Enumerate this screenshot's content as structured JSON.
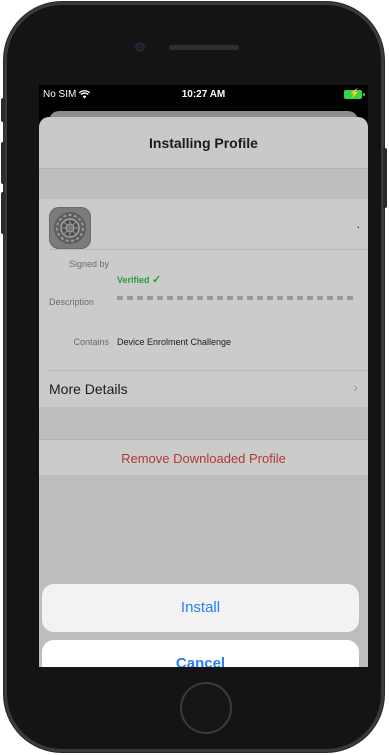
{
  "status_bar": {
    "carrier": "No SIM",
    "time": "10:27 AM"
  },
  "sheet": {
    "title": "Installing Profile"
  },
  "profile": {
    "name": ".",
    "signed_by_label": "Signed by",
    "verified_text": "Verified",
    "description_label": "Description",
    "contains_label": "Contains",
    "contains_value": "Device Enrolment Challenge",
    "more_details": "More Details"
  },
  "remove_profile": "Remove Downloaded Profile",
  "actions": {
    "install": "Install",
    "cancel": "Cancel"
  },
  "colors": {
    "verified": "#2a9c3b",
    "destructive": "#b03a33",
    "action_blue": "#2b7ef6",
    "battery": "#37d34a"
  },
  "icons": [
    "wifi-icon",
    "battery-charging-icon",
    "settings-gear-icon",
    "checkmark-icon",
    "chevron-right-icon"
  ]
}
